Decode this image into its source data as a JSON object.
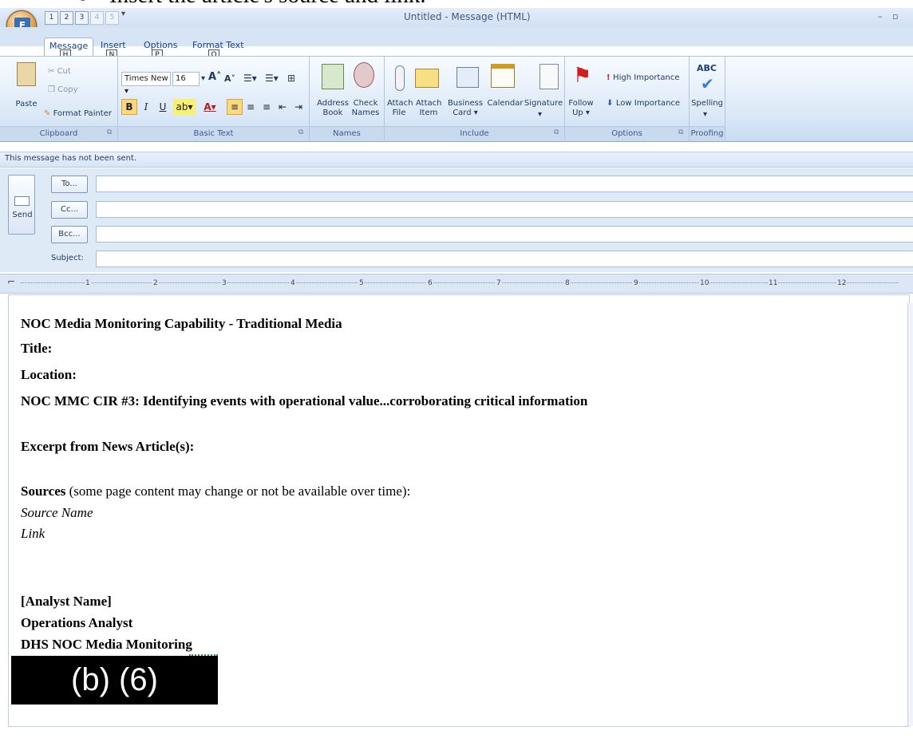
{
  "caption": "Insert the article's source and link.",
  "window": {
    "title": "Untitled - Message (HTML)",
    "minimize": "–",
    "restore": "▫"
  },
  "office_button": {
    "letter": "E"
  },
  "quick_access": [
    "1",
    "2",
    "3",
    "4",
    "5"
  ],
  "tabs": [
    {
      "label": "Message",
      "keytip": "H",
      "active": true
    },
    {
      "label": "Insert",
      "keytip": "N"
    },
    {
      "label": "Options",
      "keytip": "P"
    },
    {
      "label": "Format Text",
      "keytip": "O"
    }
  ],
  "ribbon": {
    "clipboard": {
      "label": "Clipboard",
      "paste": "Paste",
      "cut": "Cut",
      "copy": "Copy",
      "format_painter": "Format Painter"
    },
    "basic_text": {
      "label": "Basic Text",
      "font_name": "Times New",
      "font_size": "16",
      "bold": "B",
      "italic": "I",
      "underline": "U"
    },
    "names": {
      "label": "Names",
      "address_book": [
        "Address",
        "Book"
      ],
      "check_names": [
        "Check",
        "Names"
      ]
    },
    "include": {
      "label": "Include",
      "attach_file": [
        "Attach",
        "File"
      ],
      "attach_item": [
        "Attach",
        "Item"
      ],
      "business_card": [
        "Business",
        "Card"
      ],
      "calendar": "Calendar",
      "signature": "Signature"
    },
    "options": {
      "label": "Options",
      "follow_up": [
        "Follow",
        "Up"
      ],
      "high_importance": "High Importance",
      "low_importance": "Low Importance"
    },
    "proofing": {
      "label": "Proofing",
      "spelling": "Spelling",
      "abc": "ABC"
    }
  },
  "info_bar": "This message has not been sent.",
  "headers": {
    "send": "Send",
    "to": "To...",
    "cc": "Cc...",
    "bcc": "Bcc...",
    "subject": "Subject:"
  },
  "ruler": [
    "1",
    "2",
    "3",
    "4",
    "5",
    "6",
    "7",
    "8",
    "9",
    "10",
    "11",
    "12"
  ],
  "body": {
    "heading": "NOC Media Monitoring Capability - Traditional Media",
    "title": "Title:",
    "location": "Location:",
    "cir": "NOC MMC CIR #3: Identifying events with operational value...corroborating critical information",
    "excerpt": "Excerpt from News Article(s):",
    "sources_bold": "Sources",
    "sources_rest": " (some page content may change or not be available over time):",
    "source_name": "Source Name",
    "link": "Link",
    "analyst_name": "[Analyst Name]",
    "role": "Operations Analyst",
    "org": "DHS NOC Media Monitoring",
    "redaction": "(b) (6)"
  },
  "colors": {
    "ribbon": "#dbe8f7",
    "accent": "#15428b",
    "highlight": "#fbd97c"
  }
}
